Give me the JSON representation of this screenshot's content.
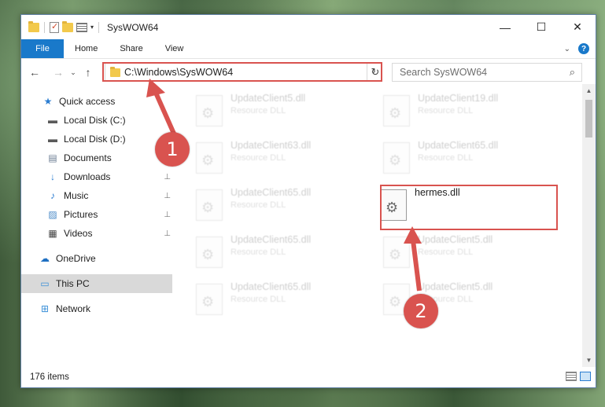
{
  "window": {
    "title": "SysWOW64",
    "minimize_glyph": "—",
    "maximize_glyph": "☐",
    "close_glyph": "✕"
  },
  "ribbon": {
    "tabs": [
      "File",
      "Home",
      "Share",
      "View"
    ],
    "help": "?"
  },
  "navigation": {
    "back": "←",
    "forward": "→",
    "recent": "⌄",
    "up": "↑",
    "address": "C:\\Windows\\SysWOW64",
    "refresh": "↻",
    "search_placeholder": "Search SysWOW64",
    "search_icon": "⌕"
  },
  "sidebar": {
    "items": [
      {
        "label": "Quick access",
        "icon": "star-icon",
        "glyph": "★",
        "color": "#2b7dd1"
      },
      {
        "label": "Local Disk (C:)",
        "icon": "drive-icon",
        "glyph": "▬",
        "color": "#5a5a5a",
        "pinned": true
      },
      {
        "label": "Local Disk (D:)",
        "icon": "drive-icon",
        "glyph": "▬",
        "color": "#5a5a5a",
        "pinned": true
      },
      {
        "label": "Documents",
        "icon": "documents-icon",
        "glyph": "▤",
        "color": "#6b7c93",
        "pinned": true
      },
      {
        "label": "Downloads",
        "icon": "download-icon",
        "glyph": "↓",
        "color": "#2b7dd1",
        "pinned": true
      },
      {
        "label": "Music",
        "icon": "music-icon",
        "glyph": "♪",
        "color": "#2b7dd1",
        "pinned": true
      },
      {
        "label": "Pictures",
        "icon": "pictures-icon",
        "glyph": "▨",
        "color": "#4a8ac7",
        "pinned": true
      },
      {
        "label": "Videos",
        "icon": "videos-icon",
        "glyph": "▦",
        "color": "#444444",
        "pinned": true
      },
      {
        "label": "OneDrive",
        "icon": "cloud-icon",
        "glyph": "☁",
        "color": "#1e6fc2"
      },
      {
        "label": "This PC",
        "icon": "computer-icon",
        "glyph": "▭",
        "color": "#3a8fd8",
        "selected": true
      },
      {
        "label": "Network",
        "icon": "network-icon",
        "glyph": "⊞",
        "color": "#3a8fd8"
      }
    ],
    "pin_glyph": "📌"
  },
  "files": [
    {
      "name": "UpdateClient5.dll",
      "type": "Resource DLL",
      "faded": true
    },
    {
      "name": "UpdateClient19.dll",
      "type": "Resource DLL",
      "faded": true
    },
    {
      "name": "UpdateClient63.dll",
      "type": "Resource DLL",
      "faded": true
    },
    {
      "name": "UpdateClient65.dll",
      "type": "Resource DLL",
      "faded": true
    },
    {
      "name": "UpdateClient65.dll",
      "type": "Resource DLL",
      "faded": true
    },
    {
      "name": "hermes.dll",
      "type": "",
      "faded": false
    },
    {
      "name": "UpdateClient65.dll",
      "type": "Resource DLL",
      "faded": true
    },
    {
      "name": "UpdateClient5.dll",
      "type": "Resource DLL",
      "faded": true
    },
    {
      "name": "UpdateClient65.dll",
      "type": "Resource DLL",
      "faded": true
    },
    {
      "name": "UpdateClient5.dll",
      "type": "Resource DLL",
      "faded": true
    }
  ],
  "status": {
    "item_count": "176 items"
  },
  "annotations": {
    "step1": "1",
    "step2": "2",
    "color": "#d9534f"
  }
}
